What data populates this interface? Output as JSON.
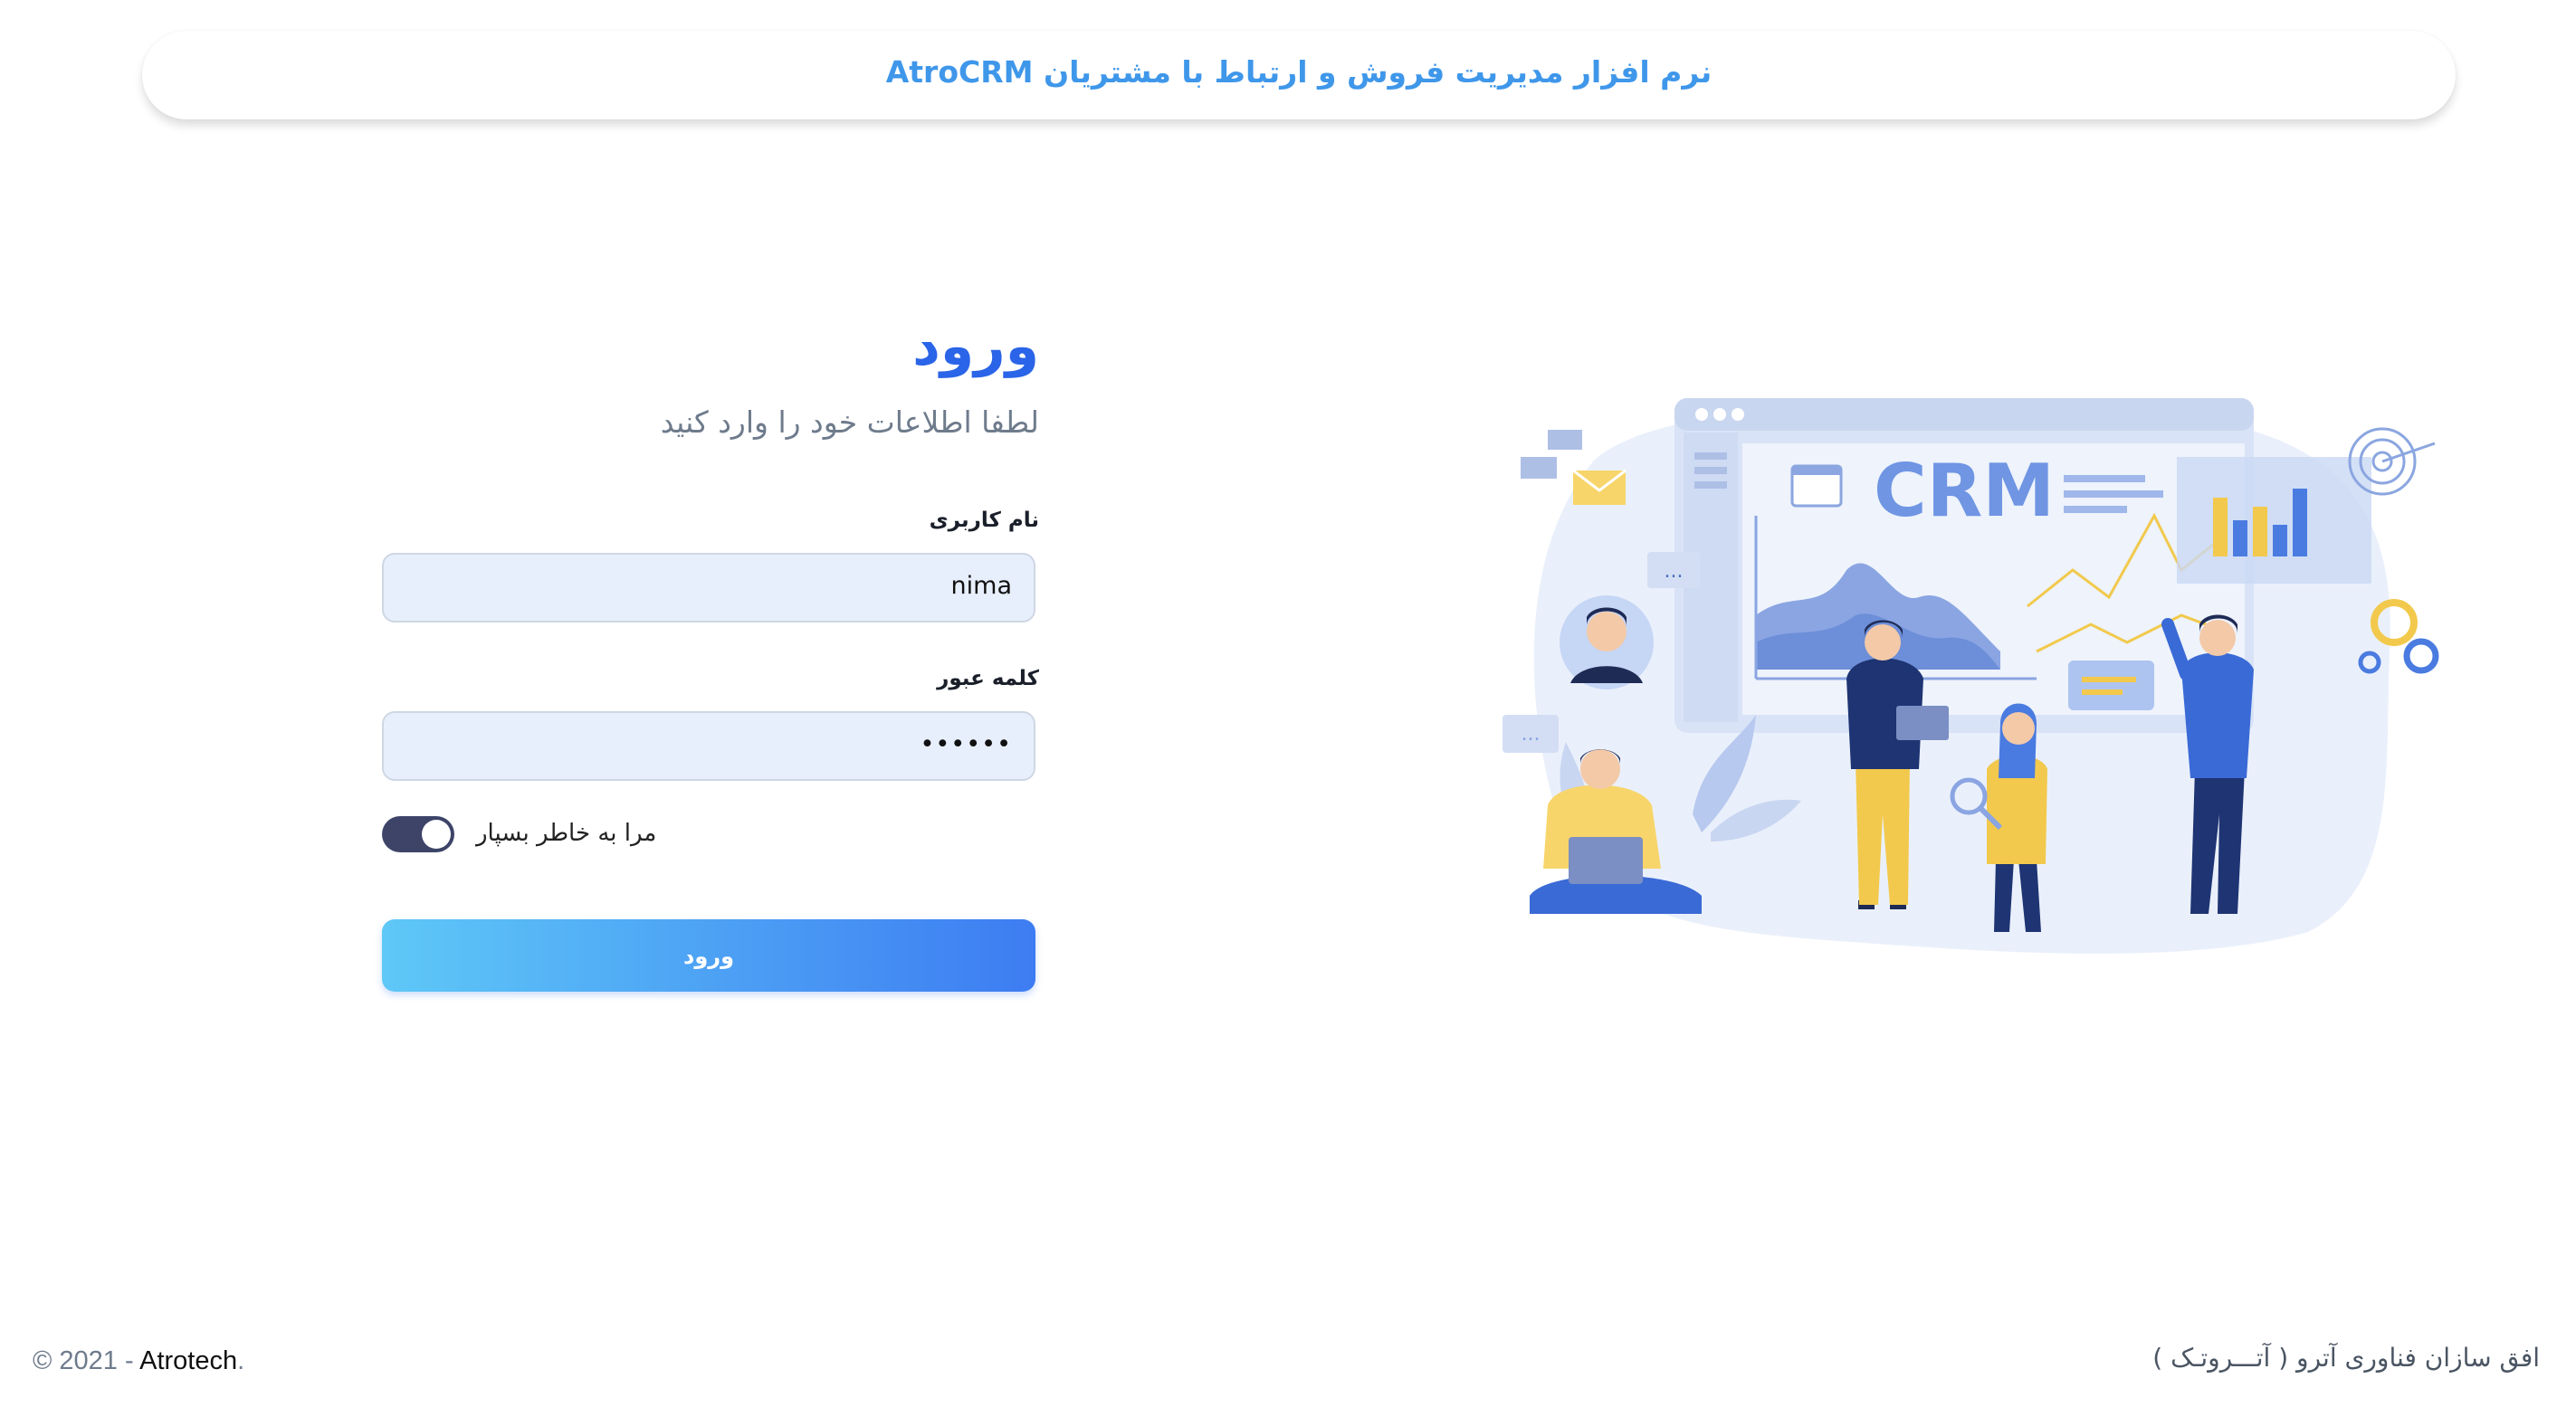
{
  "header": {
    "title": "نرم افزار مدیریت فروش و ارتباط با مشتریان AtroCRM"
  },
  "login": {
    "title": "ورود",
    "subtitle": "لطفا اطلاعات خود را وارد کنید",
    "username_label": "نام کاربری",
    "username_value": "nima",
    "password_label": "کلمه عبور",
    "password_value": "••••••",
    "remember_label": "مرا به خاطر بسپار",
    "remember_checked": true,
    "submit_label": "ورود"
  },
  "illustration": {
    "crm_text": "CRM",
    "chat_dots": "..."
  },
  "footer": {
    "copyright_prefix": "© 2021 - ",
    "brand": "Atrotech",
    "brand_suffix": ".",
    "company": "افق سازان فناوری آترو ( آتـــروتـک )"
  },
  "colors": {
    "accent": "#2a64e8",
    "header_text": "#3f97ea",
    "toggle": "#3d4468",
    "button_start": "#5ec8f7",
    "button_end": "#3d7cf2"
  }
}
